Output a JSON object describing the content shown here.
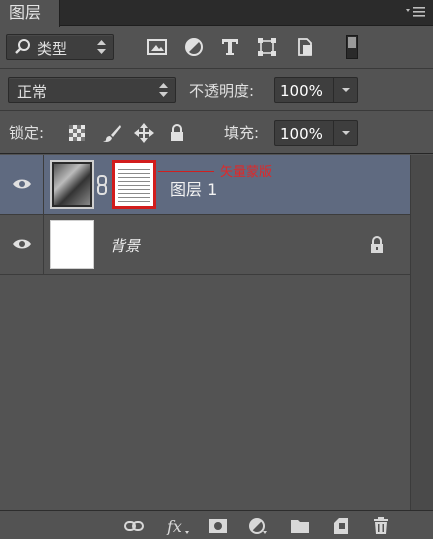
{
  "panel": {
    "tab_label": "图层"
  },
  "filter": {
    "kind_label": "类型"
  },
  "blend": {
    "mode_label": "正常",
    "opacity_label": "不透明度:",
    "opacity_value": "100%"
  },
  "lock": {
    "label": "锁定:",
    "fill_label": "填充:",
    "fill_value": "100%"
  },
  "layers": [
    {
      "name": "图层 1",
      "selected": true,
      "annotation": "矢量蒙版"
    },
    {
      "name": "背景",
      "selected": false
    }
  ],
  "colors": {
    "panel_bg": "#535353",
    "selected_row": "#5f6a80",
    "annotation": "#d21c1c"
  }
}
